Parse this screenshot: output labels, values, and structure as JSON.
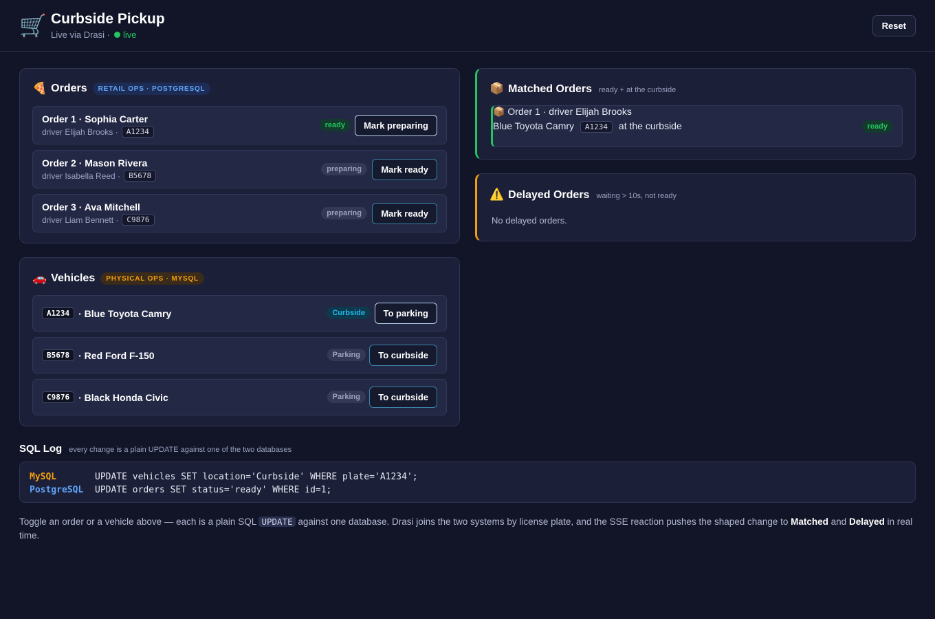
{
  "header": {
    "logo": "🛒",
    "title": "Curbside Pickup",
    "subtitle_prefix": "Live via Drasi ·",
    "status": "live",
    "reset_label": "Reset"
  },
  "orders": {
    "emoji": "🍕",
    "title": "Orders",
    "tag": "RETAIL OPS · POSTGRESQL",
    "items": [
      {
        "title": "Order 1 · Sophia Carter",
        "driver": "driver Elijah Brooks ·",
        "plate": "A1234",
        "status": "ready",
        "action": "Mark preparing"
      },
      {
        "title": "Order 2 · Mason Rivera",
        "driver": "driver Isabella Reed ·",
        "plate": "B5678",
        "status": "preparing",
        "action": "Mark ready"
      },
      {
        "title": "Order 3 · Ava Mitchell",
        "driver": "driver Liam Bennett ·",
        "plate": "C9876",
        "status": "preparing",
        "action": "Mark ready"
      }
    ]
  },
  "vehicles": {
    "emoji": "🚗",
    "title": "Vehicles",
    "tag": "PHYSICAL OPS · MYSQL",
    "items": [
      {
        "plate": "A1234",
        "name": "· Blue Toyota Camry",
        "location": "Curbside",
        "action": "To parking"
      },
      {
        "plate": "B5678",
        "name": "· Red Ford F-150",
        "location": "Parking",
        "action": "To curbside"
      },
      {
        "plate": "C9876",
        "name": "· Black Honda Civic",
        "location": "Parking",
        "action": "To curbside"
      }
    ]
  },
  "matched": {
    "emoji": "📦",
    "title": "Matched Orders",
    "hint": "ready + at the curbside",
    "items": [
      {
        "emoji": "📦",
        "title": "Order 1 · driver Elijah Brooks",
        "vehicle": "Blue Toyota Camry",
        "plate": "A1234",
        "where": "at the curbside",
        "status": "ready"
      }
    ]
  },
  "delayed": {
    "emoji": "⚠️",
    "title": "Delayed Orders",
    "hint": "waiting > 10s, not ready",
    "empty": "No delayed orders."
  },
  "sql_log": {
    "title": "SQL Log",
    "hint": "every change is a plain UPDATE against one of the two databases",
    "lines": [
      {
        "db": "MySQL",
        "stmt": "UPDATE vehicles SET location='Curbside' WHERE plate='A1234';"
      },
      {
        "db": "PostgreSQL",
        "stmt": "UPDATE orders SET status='ready' WHERE id=1;"
      }
    ]
  },
  "footer": {
    "t1": "Toggle an order or a vehicle above — each is a plain SQL",
    "code": "UPDATE",
    "t2": "against one database. Drasi joins the two systems by license plate, and the SSE reaction pushes the shaped change to",
    "b1": "Matched",
    "t3": "and",
    "b2": "Delayed",
    "t4": "in real time."
  },
  "colors": {
    "background": "#121527",
    "panel": "#1b1f37",
    "live": "#22c55e",
    "matched_accent": "#22c55e",
    "delayed_accent": "#f59e0b",
    "postgres": "#60a5fa",
    "mysql": "#f59e0b"
  }
}
